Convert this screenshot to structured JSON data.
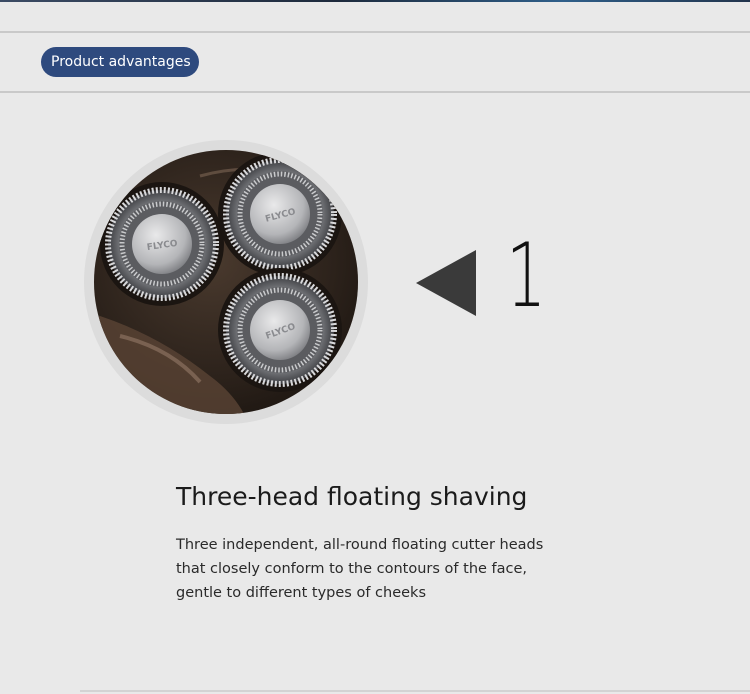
{
  "section_badge": {
    "label": "Product advantages"
  },
  "feature": {
    "number": "1",
    "title": "Three-head floating shaving",
    "description_lines": [
      "Three independent, all-round floating cutter heads",
      "that closely conform to the contours of the face,",
      "gentle to different types of cheeks"
    ],
    "photo": {
      "subject": "three-head rotary shaver cutter heads",
      "head_brand_text": "FLYCO"
    }
  },
  "icons": {
    "pointer": "triangle-left-icon"
  },
  "colors": {
    "background": "#e9e9e9",
    "badge": "#2e4a7e",
    "badge_text": "#ffffff",
    "pointer": "#3a3a3a",
    "title_text": "#1b1b1b",
    "body_text": "#2a2a2a"
  }
}
